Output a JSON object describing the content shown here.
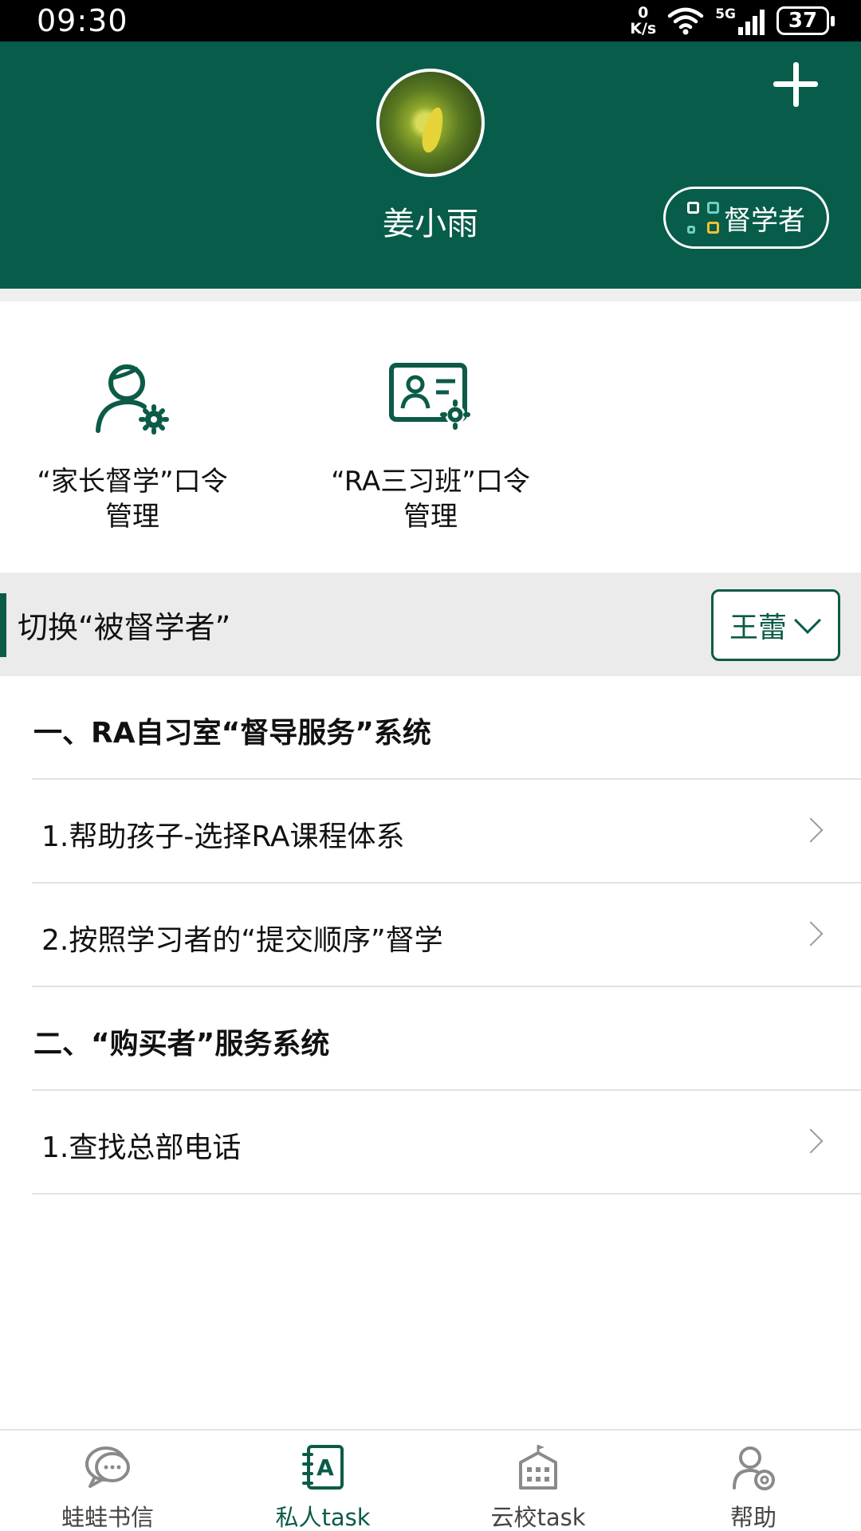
{
  "status_bar": {
    "time": "09:30",
    "net_speed_value": "0",
    "net_speed_unit": "K/s",
    "signal": "5G",
    "battery": "37"
  },
  "header": {
    "username": "姜小雨",
    "supervisor_button": "督学者",
    "background_color": "#085c4a"
  },
  "quick_actions": [
    {
      "label": "“家长督学”口令\n管理",
      "icon": "user-settings-icon"
    },
    {
      "label": "“RA三习班”口令\n管理",
      "icon": "id-card-settings-icon"
    }
  ],
  "switch_row": {
    "label": "切换“被督学者”",
    "selected": "王蕾"
  },
  "menu": {
    "section1": "一、RA自习室“督导服务”系统",
    "item1": "1.帮助孩子-选择RA课程体系",
    "item2": "2.按照学习者的“提交顺序”督学",
    "section2": "二、“购买者”服务系统",
    "item3": "1.查找总部电话"
  },
  "bottom_nav": [
    {
      "label": "蛙蛙书信",
      "icon": "chat-bubble-icon",
      "active": false
    },
    {
      "label": "私人task",
      "icon": "notebook-icon",
      "active": true
    },
    {
      "label": "云校task",
      "icon": "school-building-icon",
      "active": false
    },
    {
      "label": "帮助",
      "icon": "help-user-icon",
      "active": false
    }
  ],
  "accent_color": "#0b5b48"
}
